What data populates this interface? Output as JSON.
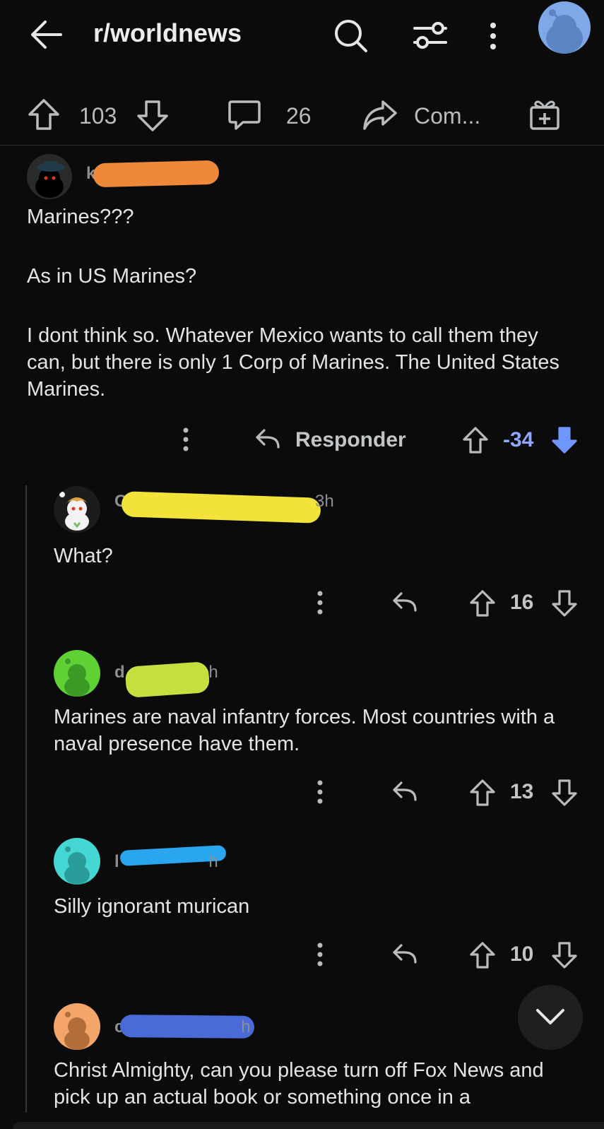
{
  "header": {
    "subreddit": "r/worldnews",
    "icons": [
      "back-arrow-icon",
      "search-icon",
      "filter-icon",
      "more-vertical-icon",
      "avatar"
    ]
  },
  "post_actions": {
    "upvotes": "103",
    "comments": "26",
    "share_label": "Com...",
    "icons": [
      "upvote-icon",
      "downvote-icon",
      "comment-icon",
      "share-icon",
      "gift-icon"
    ]
  },
  "comments": [
    {
      "username_visible": "k",
      "body": [
        "Marines???",
        "As in US Marines?",
        "I dont think so. Whatever Mexico wants to call them they can, but there is only 1 Corp of Marines.  The United States Marines."
      ],
      "reply_label": "Responder",
      "score": "-34",
      "vote_state": "downvoted"
    },
    {
      "username_visible": "Co",
      "time": "3h",
      "body": [
        "What?"
      ],
      "score": "16"
    },
    {
      "username_visible": "d",
      "time": "3h",
      "body": [
        "Marines are naval infantry forces. Most countries with a naval presence have them."
      ],
      "score": "13"
    },
    {
      "username_visible": "l",
      "time": "3h",
      "body": [
        "Silly ignorant murican"
      ],
      "score": "10"
    },
    {
      "username_visible": "c",
      "time": "3h",
      "body": [
        "Christ Almighty, can you please turn off Fox News and pick up an actual book or something once in a"
      ]
    }
  ],
  "colors": {
    "background": "#0b0b0b",
    "downvote_active": "#7193ff",
    "redact_orange": "#f0883a",
    "redact_yellow": "#f2e23a",
    "redact_lime": "#c7df3e",
    "redact_cyan": "#2aa6f0",
    "redact_blue": "#4a6ad8"
  }
}
